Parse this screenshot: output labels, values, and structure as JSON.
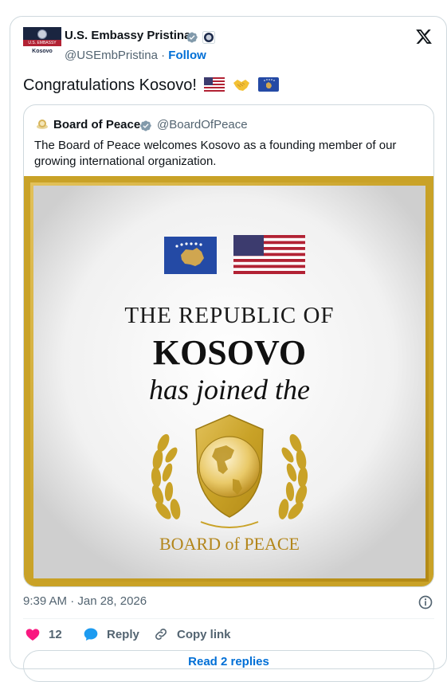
{
  "tweet": {
    "author_name": "U.S. Embassy Pristina",
    "author_handle": "@USEmbPristina",
    "separator": "·",
    "follow_label": "Follow",
    "avatar_text_top": "U.S. EMBASSY",
    "avatar_text_bottom": "Kosovo",
    "text": "Congratulations Kosovo!",
    "timestamp": "9:39 AM · Jan 28, 2026",
    "like_count": "12",
    "reply_label": "Reply",
    "copy_link_label": "Copy link",
    "bottom_button_label": "Read 2 replies"
  },
  "quote": {
    "author_name": "Board of Peace",
    "author_handle": "@BoardOfPeace",
    "text": "The Board of Peace welcomes Kosovo as a founding member of our growing international organization."
  },
  "image": {
    "line1": "THE REPUBLIC OF",
    "line2": "KOSOVO",
    "line3": "has joined the",
    "logo_text": "BOARD of PEACE"
  },
  "colors": {
    "follow": "#006fd6",
    "heart": "#f91880",
    "gold": "#c9a227",
    "kosovo_blue": "#244aa5"
  },
  "icons": [
    "verified-badge-icon",
    "seal-icon",
    "x-logo-icon",
    "info-icon",
    "heart-icon",
    "reply-icon",
    "link-icon"
  ]
}
